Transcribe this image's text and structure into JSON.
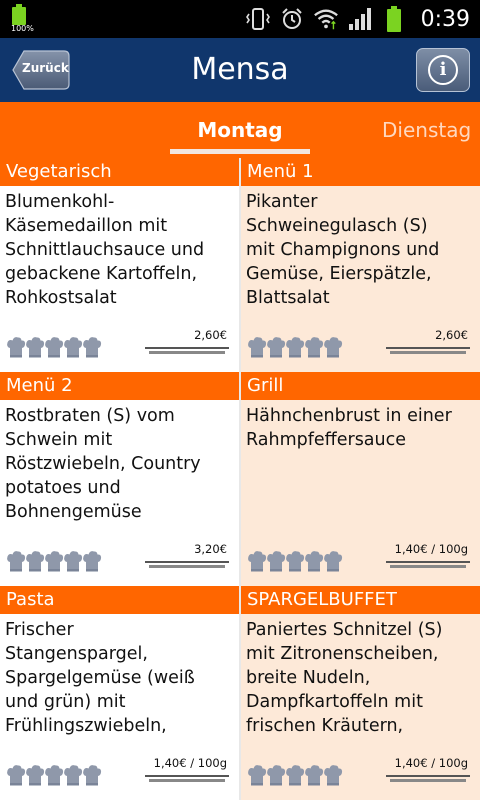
{
  "status_bar": {
    "battery_percent": "100%",
    "time": "0:39",
    "icons": [
      "vibrate-icon",
      "alarm-icon",
      "wifi-icon",
      "signal-icon",
      "battery-icon"
    ]
  },
  "header": {
    "back_label": "Zurück",
    "title": "Mensa",
    "info_icon": "info-icon"
  },
  "tabs": {
    "active": "Montag",
    "next": "Dienstag"
  },
  "menu": [
    {
      "category": "Vegetarisch",
      "description": "Blumenkohl-\nKäsemedaillon mit\nSchnittlauchsauce und\ngebackene Kartoffeln,\nRohkostsalat",
      "price": "2,60€",
      "rating": 0
    },
    {
      "category": "Menü 1",
      "description": "Pikanter\nSchweinegulasch (S)\nmit Champignons und\nGemüse,  Eierspätzle,\nBlattsalat",
      "price": "2,60€",
      "rating": 0
    },
    {
      "category": "Menü 2",
      "description": "Rostbraten (S)  vom\nSchwein mit\nRöstzwiebeln, Country\npotatoes und\nBohnengemüse",
      "price": "3,20€",
      "rating": 0
    },
    {
      "category": "Grill",
      "description": "Hähnchenbrust in einer\nRahmpfeffersauce",
      "price": "1,40€ / 100g",
      "rating": 0
    },
    {
      "category": "Pasta",
      "description": "Frischer\nStangenspargel,\nSpargelgemüse (weiß\nund grün) mit\nFrühlingszwiebeln,",
      "price": "1,40€ / 100g",
      "rating": 0
    },
    {
      "category": "SPARGELBUFFET",
      "description": "Paniertes Schnitzel (S)\nmit Zitronenscheiben,\nbreite Nudeln,\nDampfkartoffeln mit\nfrischen Kräutern,",
      "price": "1,40€ / 100g",
      "rating": 0
    }
  ],
  "colors": {
    "header_bg": "#10366c",
    "accent": "#ff6600",
    "right_cell_bg": "#fde9d8"
  }
}
